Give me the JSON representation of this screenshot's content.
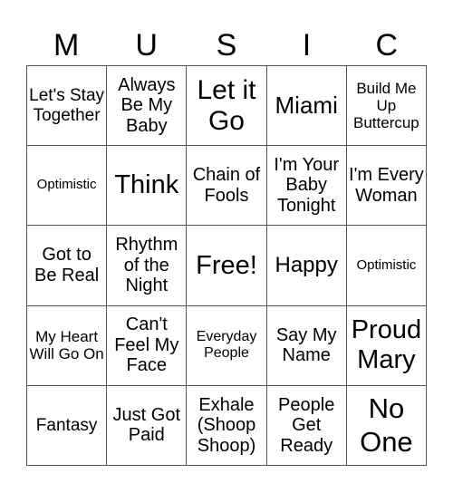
{
  "title": [
    "M",
    "U",
    "S",
    "I",
    "C"
  ],
  "cells": [
    [
      "Let's Stay Together",
      "Always Be My Baby",
      "Let it Go",
      "Miami",
      "Build Me Up Buttercup"
    ],
    [
      "Optimistic",
      "Think",
      "Chain of Fools",
      "I'm Your Baby Tonight",
      "I'm Every Woman"
    ],
    [
      "Got to Be Real",
      "Rhythm of the Night",
      "Free!",
      "Happy",
      "Optimistic"
    ],
    [
      "My Heart Will Go On",
      "Can't Feel My Face",
      "Everyday People",
      "Say My Name",
      "Proud Mary"
    ],
    [
      "Fantasy",
      "Just Got Paid",
      "Exhale (Shoop Shoop)",
      "People Get Ready",
      "No One"
    ]
  ]
}
